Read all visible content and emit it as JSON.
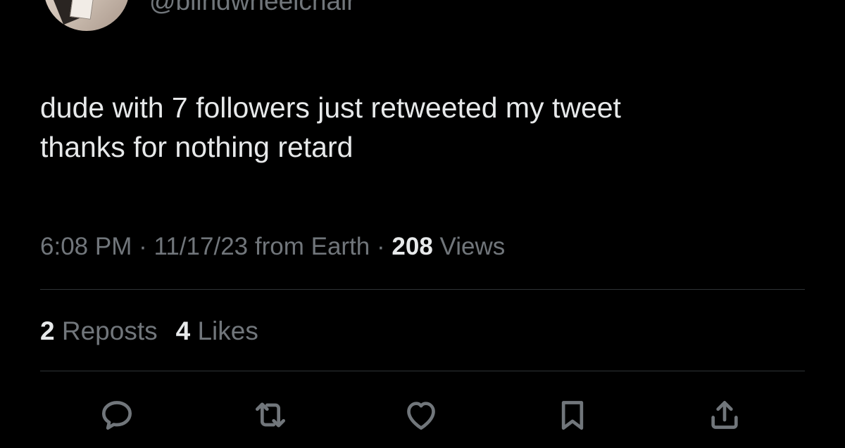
{
  "author": {
    "handle": "@blindwheelchair"
  },
  "tweet": {
    "text_lines": [
      "dude with 7 followers just retweeted my tweet",
      "thanks for nothing retard"
    ],
    "time": "6:08 PM",
    "date": "11/17/23",
    "source": "from Earth",
    "separator": "·",
    "views_count": "208",
    "views_label": "Views"
  },
  "stats": {
    "reposts_count": "2",
    "reposts_label": "Reposts",
    "likes_count": "4",
    "likes_label": "Likes"
  },
  "actions": [
    {
      "name": "reply",
      "icon": "reply-icon"
    },
    {
      "name": "repost",
      "icon": "repost-icon"
    },
    {
      "name": "like",
      "icon": "heart-icon"
    },
    {
      "name": "bookmark",
      "icon": "bookmark-icon"
    },
    {
      "name": "share",
      "icon": "share-icon"
    }
  ],
  "colors": {
    "background": "#000000",
    "text_primary": "#e7e9ea",
    "text_secondary": "#71767b",
    "divider": "#2f3336"
  }
}
